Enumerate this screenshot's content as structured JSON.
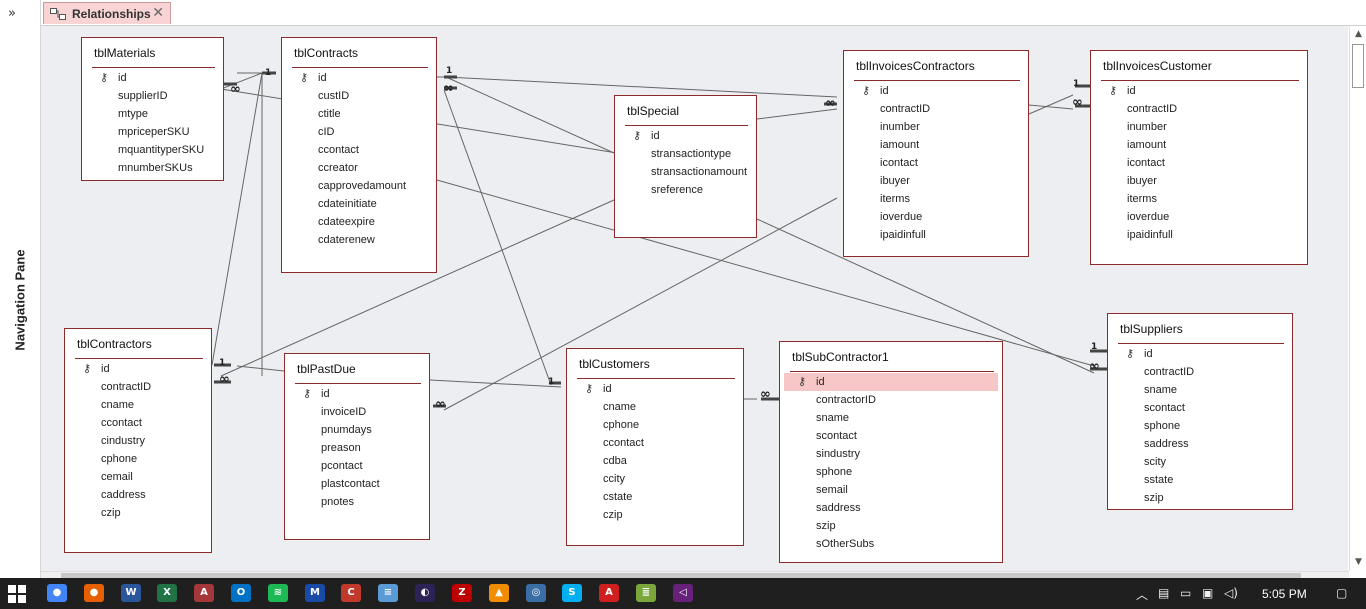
{
  "navigation_pane": {
    "label": "Navigation Pane",
    "expand_glyph": "»"
  },
  "tab": {
    "label": "Relationships",
    "close_glyph": "✕"
  },
  "tables": [
    {
      "name": "tblMaterials",
      "fields": [
        "id",
        "supplierID",
        "mtype",
        "mpriceperSKU",
        "mquantityperSKU",
        "mnumberSKUs"
      ],
      "key_field": "id"
    },
    {
      "name": "tblContracts",
      "fields": [
        "id",
        "custID",
        "ctitle",
        "cID",
        "ccontact",
        "ccreator",
        "capprovedamount",
        "cdateinitiate",
        "cdateexpire",
        "cdaterenew"
      ],
      "key_field": "id"
    },
    {
      "name": "tblSpecial",
      "fields": [
        "id",
        "stransactiontype",
        "stransactionamount",
        "sreference"
      ],
      "key_field": "id"
    },
    {
      "name": "tblInvoicesContractors",
      "fields": [
        "id",
        "contractID",
        "inumber",
        "iamount",
        "icontact",
        "ibuyer",
        "iterms",
        "ioverdue",
        "ipaidinfull"
      ],
      "key_field": "id"
    },
    {
      "name": "tblInvoicesCustomer",
      "fields": [
        "id",
        "contractID",
        "inumber",
        "iamount",
        "icontact",
        "ibuyer",
        "iterms",
        "ioverdue",
        "ipaidinfull"
      ],
      "key_field": "id"
    },
    {
      "name": "tblContractors",
      "fields": [
        "id",
        "contractID",
        "cname",
        "ccontact",
        "cindustry",
        "cphone",
        "cemail",
        "caddress",
        "czip"
      ],
      "key_field": "id"
    },
    {
      "name": "tblPastDue",
      "fields": [
        "id",
        "invoiceID",
        "pnumdays",
        "preason",
        "pcontact",
        "plastcontact",
        "pnotes"
      ],
      "key_field": "id"
    },
    {
      "name": "tblCustomers",
      "fields": [
        "id",
        "cname",
        "cphone",
        "ccontact",
        "cdba",
        "ccity",
        "cstate",
        "czip"
      ],
      "key_field": "id"
    },
    {
      "name": "tblSubContractor1",
      "fields": [
        "id",
        "contractorID",
        "sname",
        "scontact",
        "sindustry",
        "sphone",
        "semail",
        "saddress",
        "szip",
        "sOtherSubs"
      ],
      "key_field": "id",
      "selected_field": "id"
    },
    {
      "name": "tblSuppliers",
      "fields": [
        "id",
        "contractID",
        "sname",
        "scontact",
        "sphone",
        "saddress",
        "scity",
        "sstate",
        "szip"
      ],
      "key_field": "id"
    }
  ],
  "relationship_markers": {
    "one": "1",
    "many": "∞"
  },
  "taskbar": {
    "apps": [
      {
        "name": "chrome-icon",
        "color": "#4285f4",
        "glyph": "●"
      },
      {
        "name": "firefox-icon",
        "color": "#e66000",
        "glyph": "●"
      },
      {
        "name": "word-icon",
        "color": "#2b579a",
        "glyph": "W"
      },
      {
        "name": "excel-icon",
        "color": "#217346",
        "glyph": "X"
      },
      {
        "name": "access-icon",
        "color": "#a4373a",
        "glyph": "A"
      },
      {
        "name": "outlook-icon",
        "color": "#0072c6",
        "glyph": "O"
      },
      {
        "name": "spotify-icon",
        "color": "#1db954",
        "glyph": "≋"
      },
      {
        "name": "malwarebytes-icon",
        "color": "#1a4aa8",
        "glyph": "M"
      },
      {
        "name": "ccleaner-icon",
        "color": "#c0392b",
        "glyph": "C"
      },
      {
        "name": "notepad-icon",
        "color": "#5b9bd5",
        "glyph": "≡"
      },
      {
        "name": "eclipse-icon",
        "color": "#2c2255",
        "glyph": "◐"
      },
      {
        "name": "filezilla-icon",
        "color": "#bf0000",
        "glyph": "Z"
      },
      {
        "name": "vlc-icon",
        "color": "#f28c00",
        "glyph": "▲"
      },
      {
        "name": "steam-icon",
        "color": "#3a6ea5",
        "glyph": "◎"
      },
      {
        "name": "skype-icon",
        "color": "#00aff0",
        "glyph": "S"
      },
      {
        "name": "acrobat-icon",
        "color": "#d01f1f",
        "glyph": "A"
      },
      {
        "name": "notepadpp-icon",
        "color": "#7aa63c",
        "glyph": "≣"
      },
      {
        "name": "visual-studio-icon",
        "color": "#68217a",
        "glyph": "◁"
      }
    ],
    "clock": "5:05 PM"
  }
}
